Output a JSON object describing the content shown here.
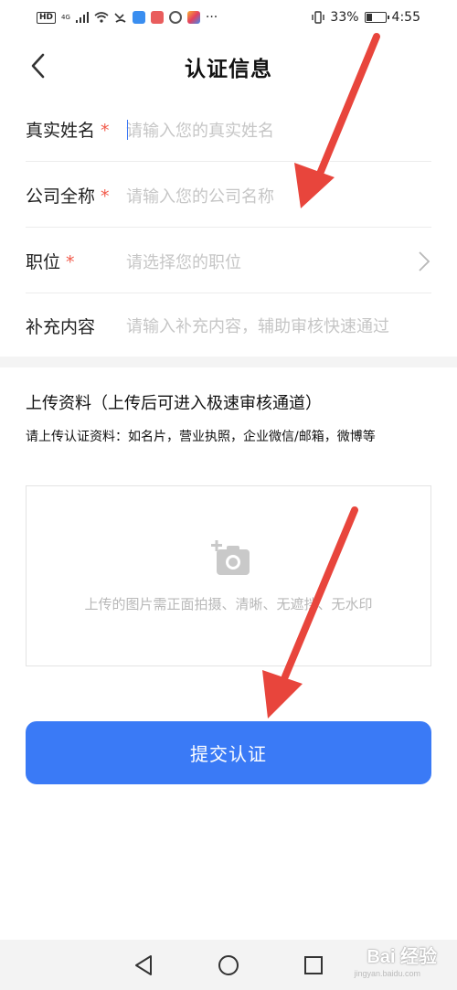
{
  "status_bar": {
    "hd": "HD",
    "net": "4G",
    "battery": "33%",
    "time": "4:55",
    "more": "···",
    "battery_fill": 0.33
  },
  "nav": {
    "title": "认证信息"
  },
  "form": {
    "required_mark": "*",
    "rows": [
      {
        "label": "真实姓名",
        "placeholder": "请输入您的真实姓名"
      },
      {
        "label": "公司全称",
        "placeholder": "请输入您的公司名称"
      },
      {
        "label": "职位",
        "placeholder": "请选择您的职位"
      },
      {
        "label": "补充内容",
        "placeholder": "请输入补充内容，辅助审核快速通过"
      }
    ]
  },
  "upload": {
    "title": "上传资料（上传后可进入极速审核通道）",
    "desc": "请上传认证资料：如名片，营业执照，企业微信/邮箱，微博等",
    "hint": "上传的图片需正面拍摄、清晰、无遮挡、无水印"
  },
  "submit": {
    "label": "提交认证"
  },
  "watermark": {
    "text": "Bai 经验",
    "sub": "jingyan.baidu.com"
  },
  "colors": {
    "accent": "#3a7af6",
    "required": "#f15a4a",
    "arrow": "#e8453c"
  }
}
